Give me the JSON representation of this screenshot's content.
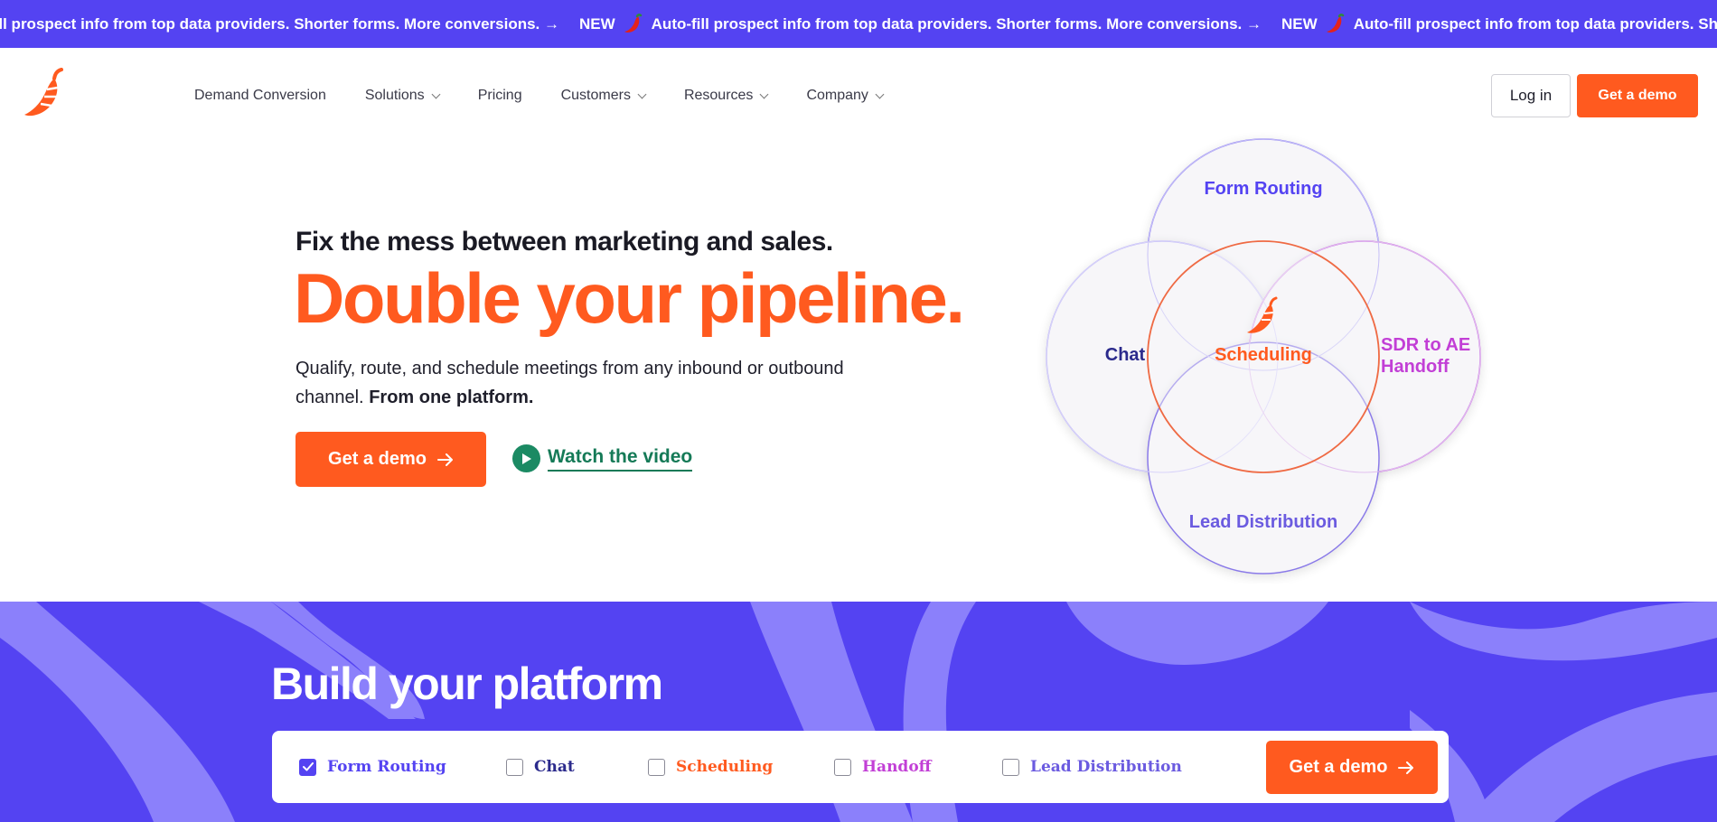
{
  "announcement": {
    "items": [
      {
        "new": "",
        "text": "fill prospect info from top data providers. Shorter forms. More conversions. →"
      },
      {
        "new": "NEW",
        "text": "Auto-fill prospect info from top data providers. Shorter forms. More conversions. →"
      },
      {
        "new": "NEW",
        "text": "Auto-fill prospect info from top data providers. Shorter forms"
      }
    ]
  },
  "nav": {
    "links": [
      {
        "label": "Demand Conversion",
        "has_dropdown": false
      },
      {
        "label": "Solutions",
        "has_dropdown": true
      },
      {
        "label": "Pricing",
        "has_dropdown": false
      },
      {
        "label": "Customers",
        "has_dropdown": true
      },
      {
        "label": "Resources",
        "has_dropdown": true
      },
      {
        "label": "Company",
        "has_dropdown": true
      }
    ],
    "login_label": "Log in",
    "demo_label": "Get a demo"
  },
  "hero": {
    "eyebrow": "Fix the mess between marketing and sales.",
    "title": "Double your pipeline.",
    "subtitle_plain": "Qualify, route, and schedule meetings from any inbound or outbound channel.",
    "subtitle_bold": "From one platform.",
    "demo_label": "Get a demo",
    "watch_label": "Watch the video"
  },
  "venn": {
    "top": "Form Routing",
    "left": "Chat",
    "center": "Scheduling",
    "right": "SDR to AE Handoff",
    "bottom": "Lead Distribution"
  },
  "builder": {
    "title": "Build your platform",
    "options": [
      {
        "label": "Form Routing",
        "checked": true,
        "color": "#5443f2"
      },
      {
        "label": "Chat",
        "checked": false,
        "color": "#2b2a8c"
      },
      {
        "label": "Scheduling",
        "checked": false,
        "color": "#ff5a1f"
      },
      {
        "label": "Handoff",
        "checked": false,
        "color": "#c23fd6"
      },
      {
        "label": "Lead Distribution",
        "checked": false,
        "color": "#6b5be0"
      }
    ],
    "demo_label": "Get a demo"
  },
  "colors": {
    "brand_purple": "#5443f2",
    "brand_orange": "#ff5a1f",
    "green": "#157a57"
  }
}
